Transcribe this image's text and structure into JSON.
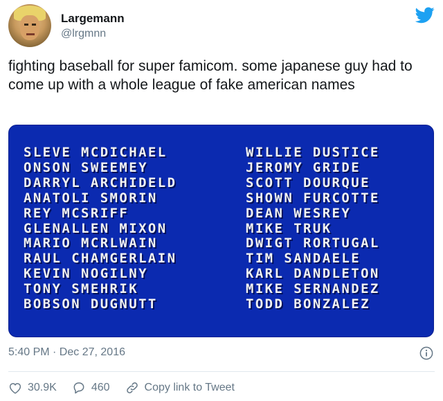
{
  "author": {
    "display_name": "Largemann",
    "handle": "@lrgmnn"
  },
  "tweet": {
    "text": "fighting baseball for super famicom. some japanese guy had to come up with a whole league of fake american names",
    "timestamp": "5:40 PM · Dec 27, 2016"
  },
  "media": {
    "left_column": [
      "SLEVE MCDICHAEL",
      "ONSON SWEEMEY",
      "DARRYL ARCHIDELD",
      "ANATOLI SMORIN",
      "REY MCSRIFF",
      "GLENALLEN MIXON",
      "MARIO MCRLWAIN",
      "RAUL CHAMGERLAIN",
      "KEVIN NOGILNY",
      "TONY SMEHRIK",
      "BOBSON DUGNUTT"
    ],
    "right_column": [
      "WILLIE DUSTICE",
      "JEROMY GRIDE",
      "SCOTT DOURQUE",
      "SHOWN FURCOTTE",
      "DEAN WESREY",
      "MIKE TRUK",
      "DWIGT RORTUGAL",
      "TIM SANDAELE",
      "KARL DANDLETON",
      "MIKE SERNANDEZ",
      "TODD BONZALEZ"
    ]
  },
  "actions": {
    "likes": "30.9K",
    "replies": "460",
    "copy_link": "Copy link to Tweet"
  },
  "icons": {
    "brand": "twitter-bird-icon",
    "info": "info-icon",
    "like": "heart-icon",
    "reply": "reply-icon",
    "link": "link-icon"
  },
  "colors": {
    "twitter_blue": "#1da1f2",
    "media_blue": "#0b2ab0",
    "secondary_text": "#657786"
  }
}
